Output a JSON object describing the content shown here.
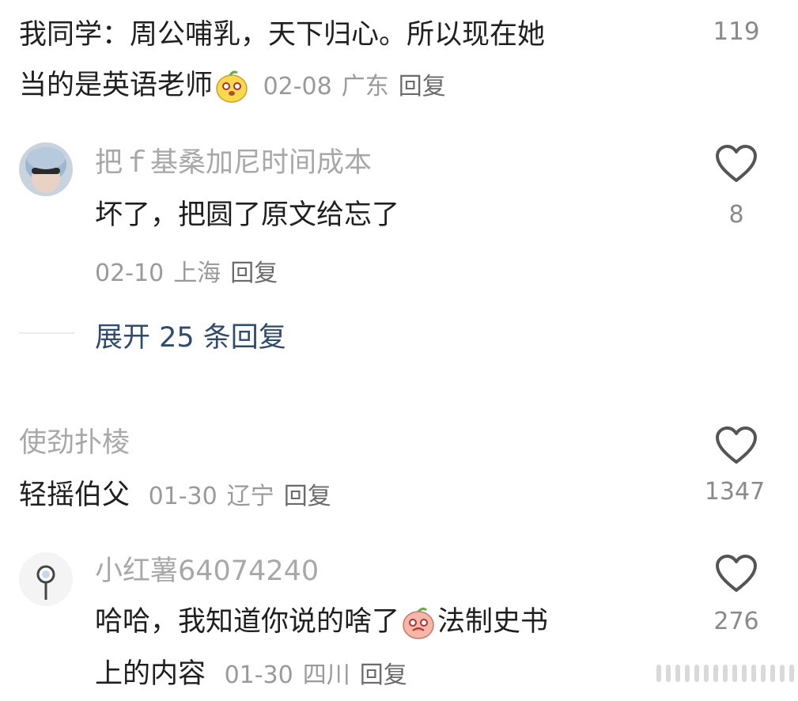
{
  "comments": [
    {
      "text_line1": "我同学：周公哺乳，天下归心。所以现在她",
      "text_line2": "当的是英语老师",
      "date": "02-08",
      "location": "广东",
      "reply_label": "回复",
      "likes": "119",
      "emoji": "pear-face-emoji"
    },
    {
      "username": "把ｆ基桑加尼时间成本",
      "text": "坏了，把圆了原文给忘了",
      "date": "02-10",
      "location": "上海",
      "reply_label": "回复",
      "likes": "8",
      "expand_label": "展开 25 条回复"
    },
    {
      "username": "使劲扑棱",
      "text": "轻摇伯父",
      "date": "01-30",
      "location": "辽宁",
      "reply_label": "回复",
      "likes": "1347"
    },
    {
      "username": "小红薯64074240",
      "text_line1_a": "哈哈，我知道你说的啥了",
      "text_line1_b": "法制史书",
      "text_line2": "上的内容",
      "date": "01-30",
      "location": "四川",
      "reply_label": "回复",
      "likes": "276",
      "emoji": "shy-peach-emoji"
    }
  ],
  "icons": {
    "like": "heart-icon",
    "accent": "#2f4b6e"
  }
}
